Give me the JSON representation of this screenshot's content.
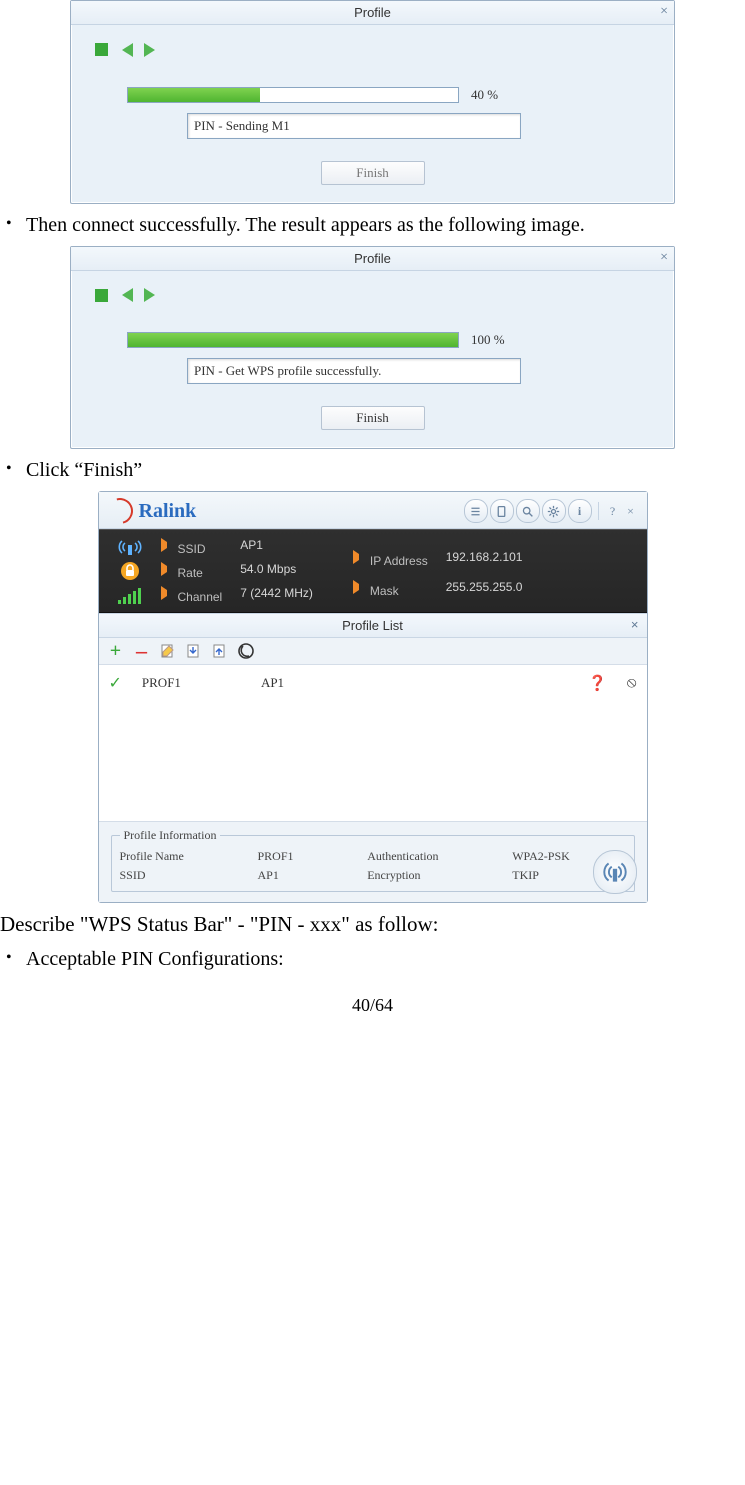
{
  "dlg1": {
    "title": "Profile",
    "progress_pct": 40,
    "progress_label": "40 %",
    "status": "PIN - Sending M1",
    "finish": "Finish"
  },
  "bullet1": "Then connect successfully. The result appears as the following image.",
  "dlg2": {
    "title": "Profile",
    "progress_pct": 100,
    "progress_label": "100 %",
    "status": "PIN - Get WPS profile successfully.",
    "finish": "Finish"
  },
  "bullet2": "Click “Finish”",
  "ralink": {
    "brand": "Ralink",
    "ssid_lbl": "SSID",
    "ssid": "AP1",
    "rate_lbl": "Rate",
    "rate": "54.0 Mbps",
    "channel_lbl": "Channel",
    "channel": "7 (2442 MHz)",
    "ip_lbl": "IP Address",
    "ip": "192.168.2.101",
    "mask_lbl": "Mask",
    "mask": "255.255.255.0",
    "profile_list_title": "Profile List",
    "row": {
      "name": "PROF1",
      "ssid": "AP1"
    },
    "info_legend": "Profile Information",
    "pn_lbl": "Profile Name",
    "pn": "PROF1",
    "pssid_lbl": "SSID",
    "pssid": "AP1",
    "auth_lbl": "Authentication",
    "auth": "WPA2-PSK",
    "enc_lbl": "Encryption",
    "enc": "TKIP"
  },
  "bodytext": "Describe \"WPS Status Bar\" - \"PIN - xxx\" as follow:",
  "bullet3": "Acceptable PIN Configurations:",
  "pagenum": "40/64"
}
